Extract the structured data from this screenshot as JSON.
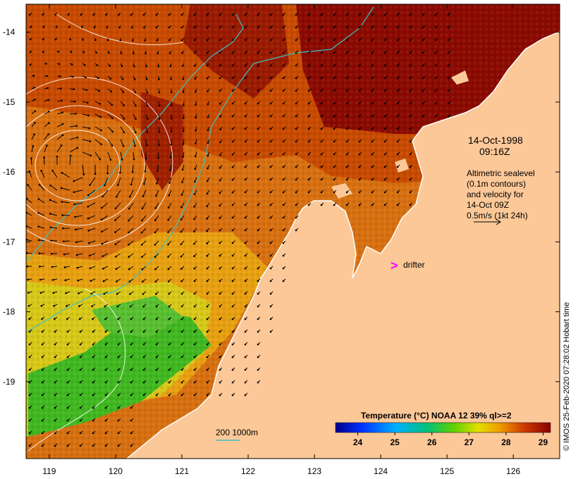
{
  "map": {
    "lat_ticks": [
      "-14",
      "-15",
      "-16",
      "-17",
      "-18",
      "-19"
    ],
    "lon_ticks": [
      "119",
      "120",
      "121",
      "122",
      "123",
      "124",
      "125",
      "126"
    ],
    "lat_range": [
      -20.1,
      -13.6
    ],
    "lon_range": [
      118.65,
      126.7
    ]
  },
  "annotation": {
    "date": "14-Oct-1998",
    "time": "09:16Z",
    "desc_lines": [
      "Altimetric sealevel",
      "(0.1m contours)",
      "and velocity for",
      "14-Oct 09Z",
      "0.5m/s (1kt 24h)"
    ]
  },
  "drifter": {
    "symbol": ">",
    "label": "drifter",
    "color": "#ff00ff"
  },
  "bathymetry_legend": {
    "label": "200  1000m",
    "color": "#40c0c0"
  },
  "colorbar": {
    "title": "Temperature (°C) NOAA 12 39% ql>=2",
    "ticks": [
      "24",
      "25",
      "26",
      "27",
      "28",
      "29"
    ],
    "range": [
      23.4,
      29.2
    ]
  },
  "credit": "© IMOS 25-Feb-2020 07:28:02 Hobart time",
  "colors": {
    "land": "#fcc898",
    "warm_dark": "#8b0a00",
    "warm": "#c84a00",
    "mid": "#e89010",
    "cool": "#40c020",
    "contour": "#ffffff",
    "isobath": "#40c0c0"
  }
}
